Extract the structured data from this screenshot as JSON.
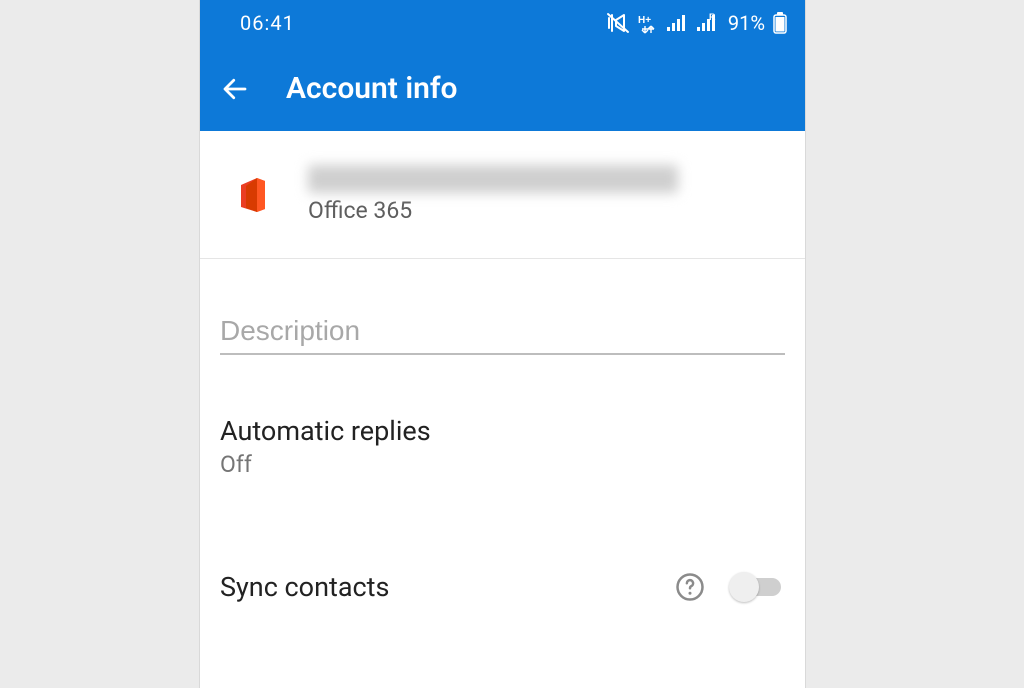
{
  "status": {
    "time": "06:41",
    "battery": "91%"
  },
  "appbar": {
    "title": "Account info"
  },
  "account": {
    "type": "Office 365"
  },
  "description": {
    "placeholder": "Description",
    "value": ""
  },
  "auto_replies": {
    "label": "Automatic replies",
    "value": "Off"
  },
  "sync": {
    "label": "Sync contacts",
    "on": false
  }
}
